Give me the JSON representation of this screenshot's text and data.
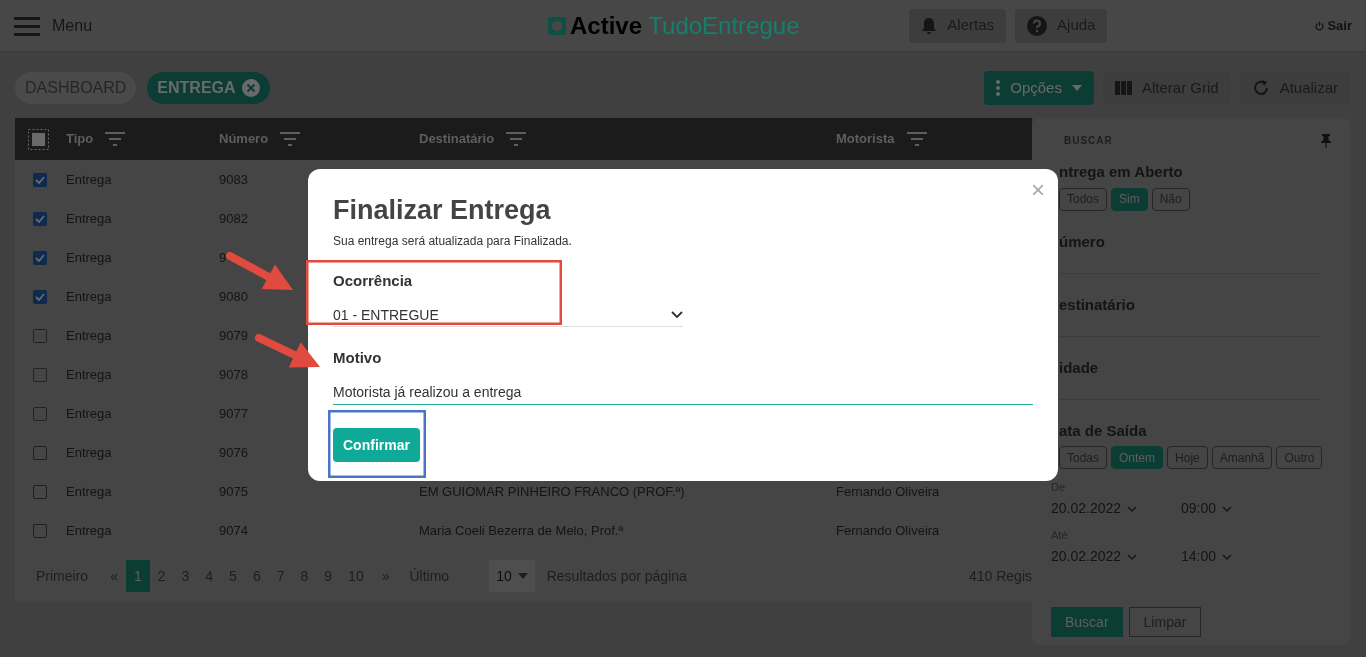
{
  "header": {
    "menu_label": "Menu",
    "logo": {
      "bold": "Active",
      "light": "TudoEntregue"
    },
    "buttons": [
      {
        "kind": "bell",
        "label": "Alertas"
      },
      {
        "kind": "help",
        "label": "Ajuda"
      }
    ],
    "logout": "Sair"
  },
  "tabs": [
    {
      "label": "DASHBOARD",
      "selected": false,
      "closable": false
    },
    {
      "label": "ENTREGA",
      "selected": true,
      "closable": true
    }
  ],
  "toolbar": [
    {
      "kind": "menu",
      "label": "Opções"
    },
    {
      "kind": "grid",
      "label": "Alterar Grid"
    },
    {
      "kind": "refresh",
      "label": "Atualizar"
    }
  ],
  "table": {
    "select_all_indeterminate": true,
    "columns": [
      "Tipo",
      "Número",
      "Destinatário",
      "Motorista"
    ],
    "rows": [
      {
        "checked": true,
        "tipo": "Entrega",
        "numero": "9083"
      },
      {
        "checked": true,
        "tipo": "Entrega",
        "numero": "9082"
      },
      {
        "checked": true,
        "tipo": "Entrega",
        "numero": "9"
      },
      {
        "checked": true,
        "tipo": "Entrega",
        "numero": "9080"
      },
      {
        "checked": false,
        "tipo": "Entrega",
        "numero": "9079"
      },
      {
        "checked": false,
        "tipo": "Entrega",
        "numero": "9078"
      },
      {
        "checked": false,
        "tipo": "Entrega",
        "numero": "9077"
      },
      {
        "checked": false,
        "tipo": "Entrega",
        "numero": "9076"
      },
      {
        "checked": false,
        "tipo": "Entrega",
        "numero": "9075",
        "destinatario": "EM GUIOMAR PINHEIRO FRANCO (PROF.ª)",
        "motorista": "Fernando Oliveira"
      },
      {
        "checked": false,
        "tipo": "Entrega",
        "numero": "9074",
        "destinatario": "Maria Coeli Bezerra de Melo, Prof.ª",
        "motorista": "Fernando Oliveira"
      }
    ]
  },
  "pagination": {
    "first": "Primeiro",
    "prev": "«",
    "pages": [
      {
        "label": "1",
        "selected": true
      },
      {
        "label": "2",
        "selected": false
      },
      {
        "label": "3",
        "selected": false
      },
      {
        "label": "4",
        "selected": false
      },
      {
        "label": "5",
        "selected": false
      },
      {
        "label": "6",
        "selected": false
      },
      {
        "label": "7",
        "selected": false
      },
      {
        "label": "8",
        "selected": false
      },
      {
        "label": "9",
        "selected": false
      },
      {
        "label": "10",
        "selected": false
      }
    ],
    "next": "»",
    "last": "Último",
    "page_size": "10",
    "page_size_label": "Resultados por página",
    "total": "410 Regis"
  },
  "search_panel": {
    "title": "BUSCAR",
    "open_filter": {
      "label": "ntrega em Aberto",
      "options": [
        {
          "label": "Todos",
          "selected": false
        },
        {
          "label": "Sim",
          "selected": true
        },
        {
          "label": "Não",
          "selected": false
        }
      ]
    },
    "fields": [
      "úmero",
      "estinatário",
      "idade"
    ],
    "date_filter": {
      "label": "ata de Saída",
      "options": [
        {
          "label": "Todas",
          "selected": false
        },
        {
          "label": "Ontem",
          "selected": true
        },
        {
          "label": "Hoje",
          "selected": false
        },
        {
          "label": "Amanhã",
          "selected": false
        },
        {
          "label": "Outro",
          "selected": false
        }
      ]
    },
    "from": {
      "label": "De",
      "date": "20.02.2022",
      "time": "09:00"
    },
    "to": {
      "label": "Até",
      "date": "20.02.2022",
      "time": "14:00"
    },
    "buttons": [
      {
        "label": "Buscar",
        "primary": true
      },
      {
        "label": "Limpar",
        "primary": false
      }
    ]
  },
  "modal": {
    "title": "Finalizar Entrega",
    "subtitle": "Sua entrega será atualizada para Finalizada.",
    "close": "×",
    "occurrence": {
      "label": "Ocorrência",
      "value": "01 - ENTREGUE"
    },
    "reason": {
      "label": "Motivo",
      "value": "Motorista já realizou a entrega"
    },
    "confirm": "Confirmar"
  }
}
